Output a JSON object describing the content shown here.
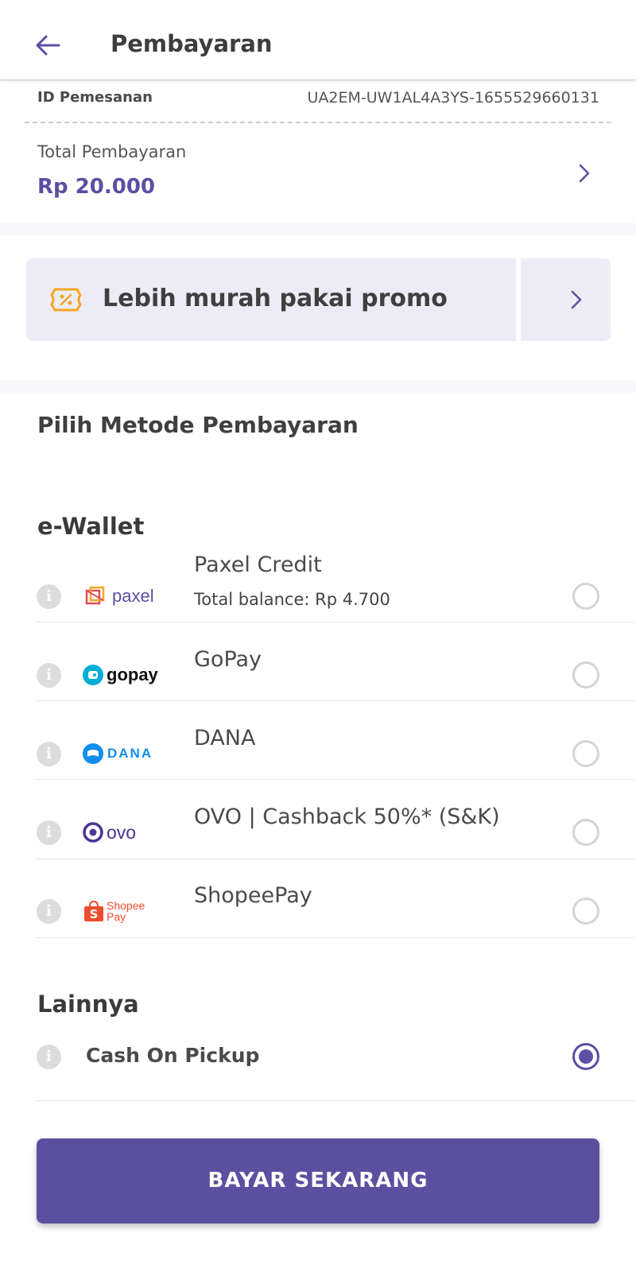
{
  "header": {
    "title": "Pembayaran",
    "back_icon": "arrow-left-icon"
  },
  "order": {
    "id_label": "ID Pemesanan",
    "id_value": "UA2EM-UW1AL4A3YS-1655529660131",
    "total_label": "Total Pembayaran",
    "total_value": "Rp 20.000"
  },
  "promo": {
    "text": "Lebih murah pakai promo",
    "icon": "discount-ticket-icon"
  },
  "methods": {
    "title": "Pilih Metode Pembayaran",
    "ewallet_title": "e-Wallet",
    "ewallet": [
      {
        "name": "Paxel Credit",
        "sub": "Total balance: Rp 4.700",
        "logo_text": "paxel"
      },
      {
        "name": "GoPay",
        "logo_text": "gopay"
      },
      {
        "name": "DANA",
        "logo_text": "DANA"
      },
      {
        "name": "OVO | Cashback 50%* (S&K)",
        "logo_text": "ovo"
      },
      {
        "name": "ShopeePay",
        "logo_text_1": "Shopee",
        "logo_text_2": "Pay"
      }
    ],
    "other_title": "Lainnya",
    "other": [
      {
        "name": "Cash On Pickup",
        "selected": true
      }
    ]
  },
  "info_glyph": "i",
  "pay_button": "BAYAR SEKARANG",
  "colors": {
    "accent": "#5a4fa3",
    "promo_bg": "#edecf6",
    "promo_icon": "#f5a623"
  }
}
